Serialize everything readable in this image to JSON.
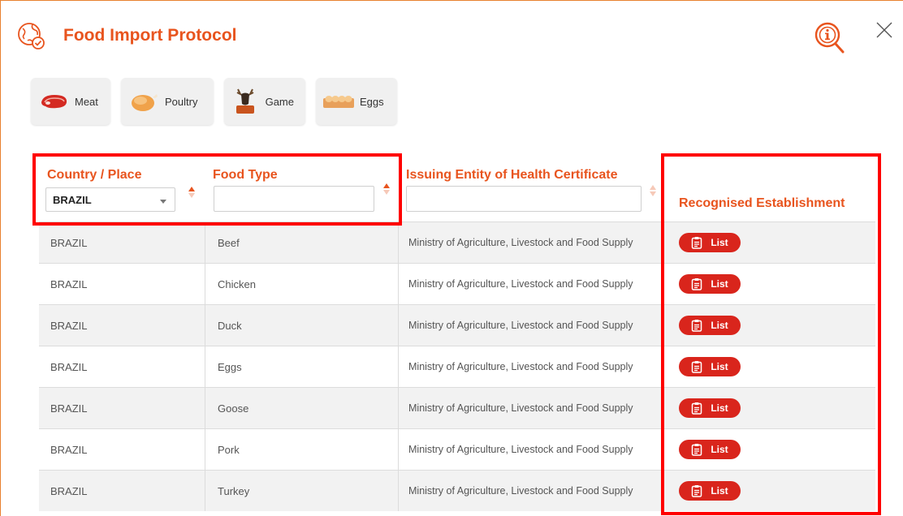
{
  "header": {
    "title": "Food Import Protocol",
    "logo_icon": "globe-check-icon",
    "info_icon": "info-search-icon",
    "close_icon": "close-icon"
  },
  "categories": [
    {
      "label": "Meat",
      "icon": "meat-icon"
    },
    {
      "label": "Poultry",
      "icon": "poultry-icon"
    },
    {
      "label": "Game",
      "icon": "game-icon"
    },
    {
      "label": "Eggs",
      "icon": "eggs-icon"
    }
  ],
  "table": {
    "columns": {
      "country": "Country / Place",
      "food_type": "Food Type",
      "issuer": "Issuing Entity of Health Certificate",
      "establishment": "Recognised Establishment"
    },
    "filters": {
      "country_selected": "BRAZIL",
      "food_type_value": "",
      "issuer_value": ""
    },
    "list_button_label": "List",
    "rows": [
      {
        "country": "BRAZIL",
        "food_type": "Beef",
        "issuer": "Ministry of Agriculture, Livestock and Food Supply"
      },
      {
        "country": "BRAZIL",
        "food_type": "Chicken",
        "issuer": "Ministry of Agriculture, Livestock and Food Supply"
      },
      {
        "country": "BRAZIL",
        "food_type": "Duck",
        "issuer": "Ministry of Agriculture, Livestock and Food Supply"
      },
      {
        "country": "BRAZIL",
        "food_type": "Eggs",
        "issuer": "Ministry of Agriculture, Livestock and Food Supply"
      },
      {
        "country": "BRAZIL",
        "food_type": "Goose",
        "issuer": "Ministry of Agriculture, Livestock and Food Supply"
      },
      {
        "country": "BRAZIL",
        "food_type": "Pork",
        "issuer": "Ministry of Agriculture, Livestock and Food Supply"
      },
      {
        "country": "BRAZIL",
        "food_type": "Turkey",
        "issuer": "Ministry of Agriculture, Livestock and Food Supply"
      }
    ]
  },
  "colors": {
    "accent": "#e8541e",
    "button_red": "#d9251c",
    "highlight": "#ff0000"
  }
}
